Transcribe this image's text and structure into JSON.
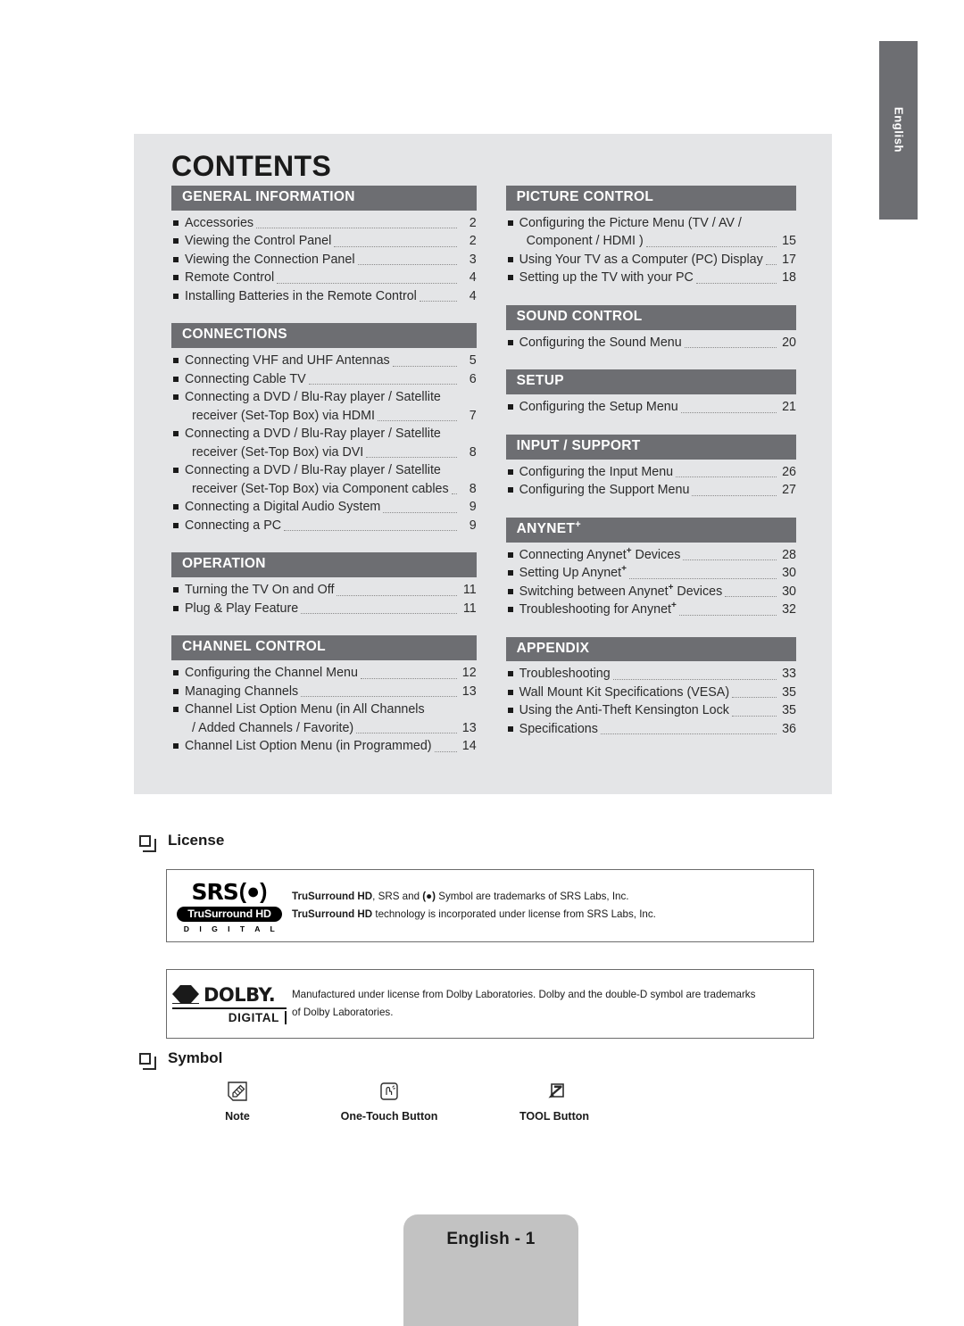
{
  "side_tab": {
    "label": "English"
  },
  "contents": {
    "title": "CONTENTS",
    "left_sections": [
      {
        "heading": "GENERAL INFORMATION",
        "entries": [
          {
            "text": "Accessories",
            "page": "2"
          },
          {
            "text": "Viewing the Control Panel",
            "page": "2"
          },
          {
            "text": "Viewing the Connection Panel",
            "page": "3"
          },
          {
            "text": "Remote Control",
            "page": "4"
          },
          {
            "text": "Installing Batteries in the Remote Control",
            "page": "4"
          }
        ]
      },
      {
        "heading": "CONNECTIONS",
        "entries": [
          {
            "text": "Connecting VHF and UHF Antennas",
            "page": "5"
          },
          {
            "text": "Connecting Cable TV",
            "page": "6"
          },
          {
            "text": "Connecting a DVD / Blu-Ray player / Satellite",
            "page": "",
            "wrap": "receiver (Set-Top Box) via HDMI",
            "wrap_page": "7"
          },
          {
            "text": "Connecting a DVD / Blu-Ray player / Satellite",
            "page": "",
            "wrap": "receiver (Set-Top Box) via DVI",
            "wrap_page": "8"
          },
          {
            "text": "Connecting a DVD / Blu-Ray player / Satellite",
            "page": "",
            "wrap": "receiver (Set-Top Box) via Component cables",
            "wrap_page": "8"
          },
          {
            "text": "Connecting a Digital Audio System",
            "page": "9"
          },
          {
            "text": "Connecting a PC",
            "page": "9"
          }
        ]
      },
      {
        "heading": "OPERATION",
        "entries": [
          {
            "text": "Turning the TV On and Off",
            "page": "11"
          },
          {
            "text": "Plug & Play Feature",
            "page": "11"
          }
        ]
      },
      {
        "heading": "CHANNEL CONTROL",
        "entries": [
          {
            "text": "Configuring the Channel Menu",
            "page": "12"
          },
          {
            "text": "Managing Channels",
            "page": "13"
          },
          {
            "text": "Channel List Option Menu (in All Channels",
            "page": "",
            "wrap": "/ Added Channels / Favorite)",
            "wrap_page": "13"
          },
          {
            "text": "Channel List Option Menu (in Programmed)",
            "page": "14"
          }
        ]
      }
    ],
    "right_sections": [
      {
        "heading": "PICTURE CONTROL",
        "entries": [
          {
            "text": "Configuring the Picture Menu (TV / AV /",
            "page": "",
            "wrap": "Component / HDMI )",
            "wrap_page": "15"
          },
          {
            "text": "Using Your TV as a Computer (PC) Display",
            "page": "17"
          },
          {
            "text": "Setting up the TV with your PC",
            "page": "18"
          }
        ]
      },
      {
        "heading": "SOUND CONTROL",
        "entries": [
          {
            "text": "Configuring the Sound Menu",
            "page": "20"
          }
        ]
      },
      {
        "heading": "SETUP",
        "entries": [
          {
            "text": "Configuring the Setup Menu",
            "page": "21"
          }
        ]
      },
      {
        "heading": "INPUT / SUPPORT",
        "entries": [
          {
            "text": "Configuring the Input Menu",
            "page": "26"
          },
          {
            "text": "Configuring the Support Menu",
            "page": "27"
          }
        ]
      },
      {
        "heading": "ANYNET",
        "heading_sup": "+",
        "entries": [
          {
            "text": "Connecting Anynet",
            "sup": "+",
            "text2": " Devices",
            "page": "28"
          },
          {
            "text": "Setting Up Anynet",
            "sup": "+",
            "text2": "",
            "page": "30"
          },
          {
            "text": "Switching between Anynet",
            "sup": "+",
            "text2": " Devices",
            "page": "30"
          },
          {
            "text": "Troubleshooting for Anynet",
            "sup": "+",
            "text2": "",
            "page": "32"
          }
        ]
      },
      {
        "heading": "APPENDIX",
        "entries": [
          {
            "text": "Troubleshooting",
            "page": "33"
          },
          {
            "text": "Wall Mount Kit Specifications (VESA)",
            "page": "35"
          },
          {
            "text": "Using the Anti-Theft Kensington Lock",
            "page": "35"
          },
          {
            "text": "Specifications",
            "page": "36"
          }
        ]
      }
    ]
  },
  "license": {
    "title": "License",
    "srs": {
      "logo_word": "SRS",
      "logo_pill": "TruSurround HD",
      "logo_digital": "D I G I T A L",
      "line1_bold": "TruSurround HD",
      "line1_rest": ", SRS and",
      "line1_tail": "Symbol are trademarks of SRS Labs, Inc.",
      "line2_bold": "TruSurround HD",
      "line2_rest": " technology is incorporated under license from SRS Labs, Inc."
    },
    "dolby": {
      "logo_word": "DOLBY.",
      "logo_sub": "DIGITAL",
      "text_line1": "Manufactured under license from Dolby Laboratories. Dolby and the double-D symbol are trademarks",
      "text_line2": "of Dolby Laboratories."
    }
  },
  "symbol": {
    "title": "Symbol",
    "items": [
      {
        "icon": "note-icon",
        "label": "Note"
      },
      {
        "icon": "one-touch-button-icon",
        "label": "One-Touch Button"
      },
      {
        "icon": "tool-button-icon",
        "label": "TOOL Button"
      }
    ]
  },
  "footer": {
    "label": "English - 1"
  }
}
